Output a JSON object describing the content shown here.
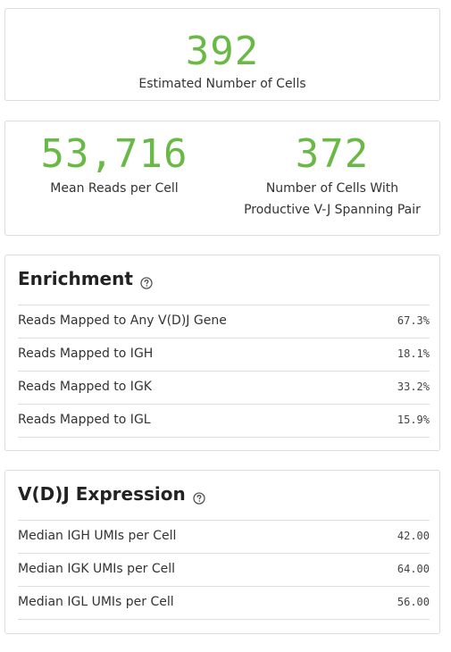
{
  "cells": {
    "value": "392",
    "label": "Estimated Number of Cells"
  },
  "reads": {
    "mean_reads": {
      "value": "53,716",
      "label": "Mean Reads per Cell"
    },
    "productive_cells": {
      "value": "372",
      "label_line1": "Number of Cells With",
      "label_line2": "Productive V-J Spanning Pair"
    }
  },
  "enrichment": {
    "title": "Enrichment",
    "rows": [
      {
        "label": "Reads Mapped to Any V(D)J Gene",
        "value": "67.3%"
      },
      {
        "label": "Reads Mapped to IGH",
        "value": "18.1%"
      },
      {
        "label": "Reads Mapped to IGK",
        "value": "33.2%"
      },
      {
        "label": "Reads Mapped to IGL",
        "value": "15.9%"
      }
    ]
  },
  "vdj_expression": {
    "title": "V(D)J Expression",
    "rows": [
      {
        "label": "Median IGH UMIs per Cell",
        "value": "42.00"
      },
      {
        "label": "Median IGK UMIs per Cell",
        "value": "64.00"
      },
      {
        "label": "Median IGL UMIs per Cell",
        "value": "56.00"
      }
    ]
  },
  "colors": {
    "accent_green": "#6ab845",
    "border": "#dcdcdc"
  },
  "icons": {
    "help": "question-circle-icon"
  }
}
